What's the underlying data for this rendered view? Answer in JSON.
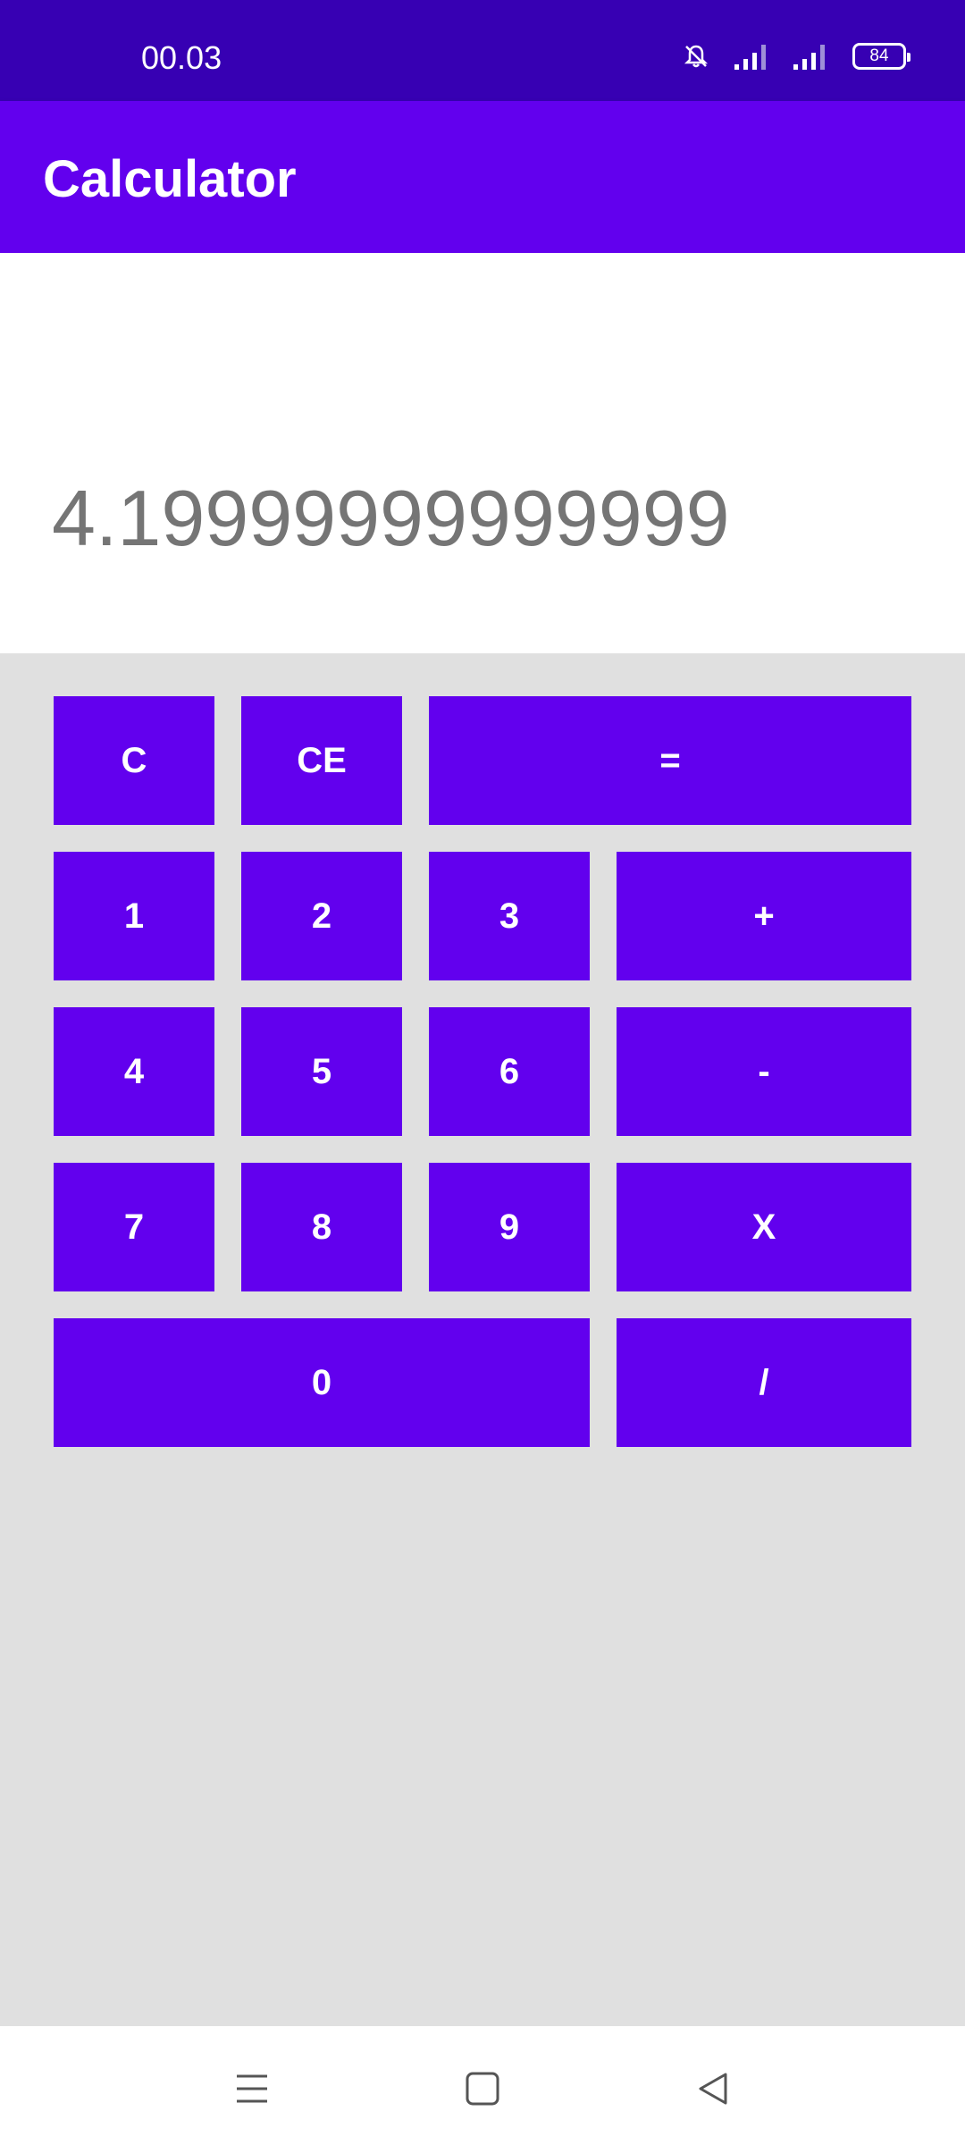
{
  "status_bar": {
    "time": "00.03",
    "battery": "84",
    "icons": [
      "bell-off-icon",
      "signal-icon",
      "signal-icon",
      "battery-icon"
    ]
  },
  "app_bar": {
    "title": "Calculator"
  },
  "display": {
    "value": "4.19999999999999"
  },
  "keys": {
    "clear": "C",
    "clear_entry": "CE",
    "equals": "=",
    "one": "1",
    "two": "2",
    "three": "3",
    "plus": "+",
    "four": "4",
    "five": "5",
    "six": "6",
    "minus": "-",
    "seven": "7",
    "eight": "8",
    "nine": "9",
    "multiply": "X",
    "zero": "0",
    "divide": "/"
  },
  "navigation_bar": {
    "icons": [
      "menu-icon",
      "home-icon",
      "back-icon"
    ]
  },
  "colors": {
    "status_bar": "#3700B3",
    "primary": "#6200EE",
    "keypad_background": "#E0E0E0",
    "display_text": "#757575"
  }
}
